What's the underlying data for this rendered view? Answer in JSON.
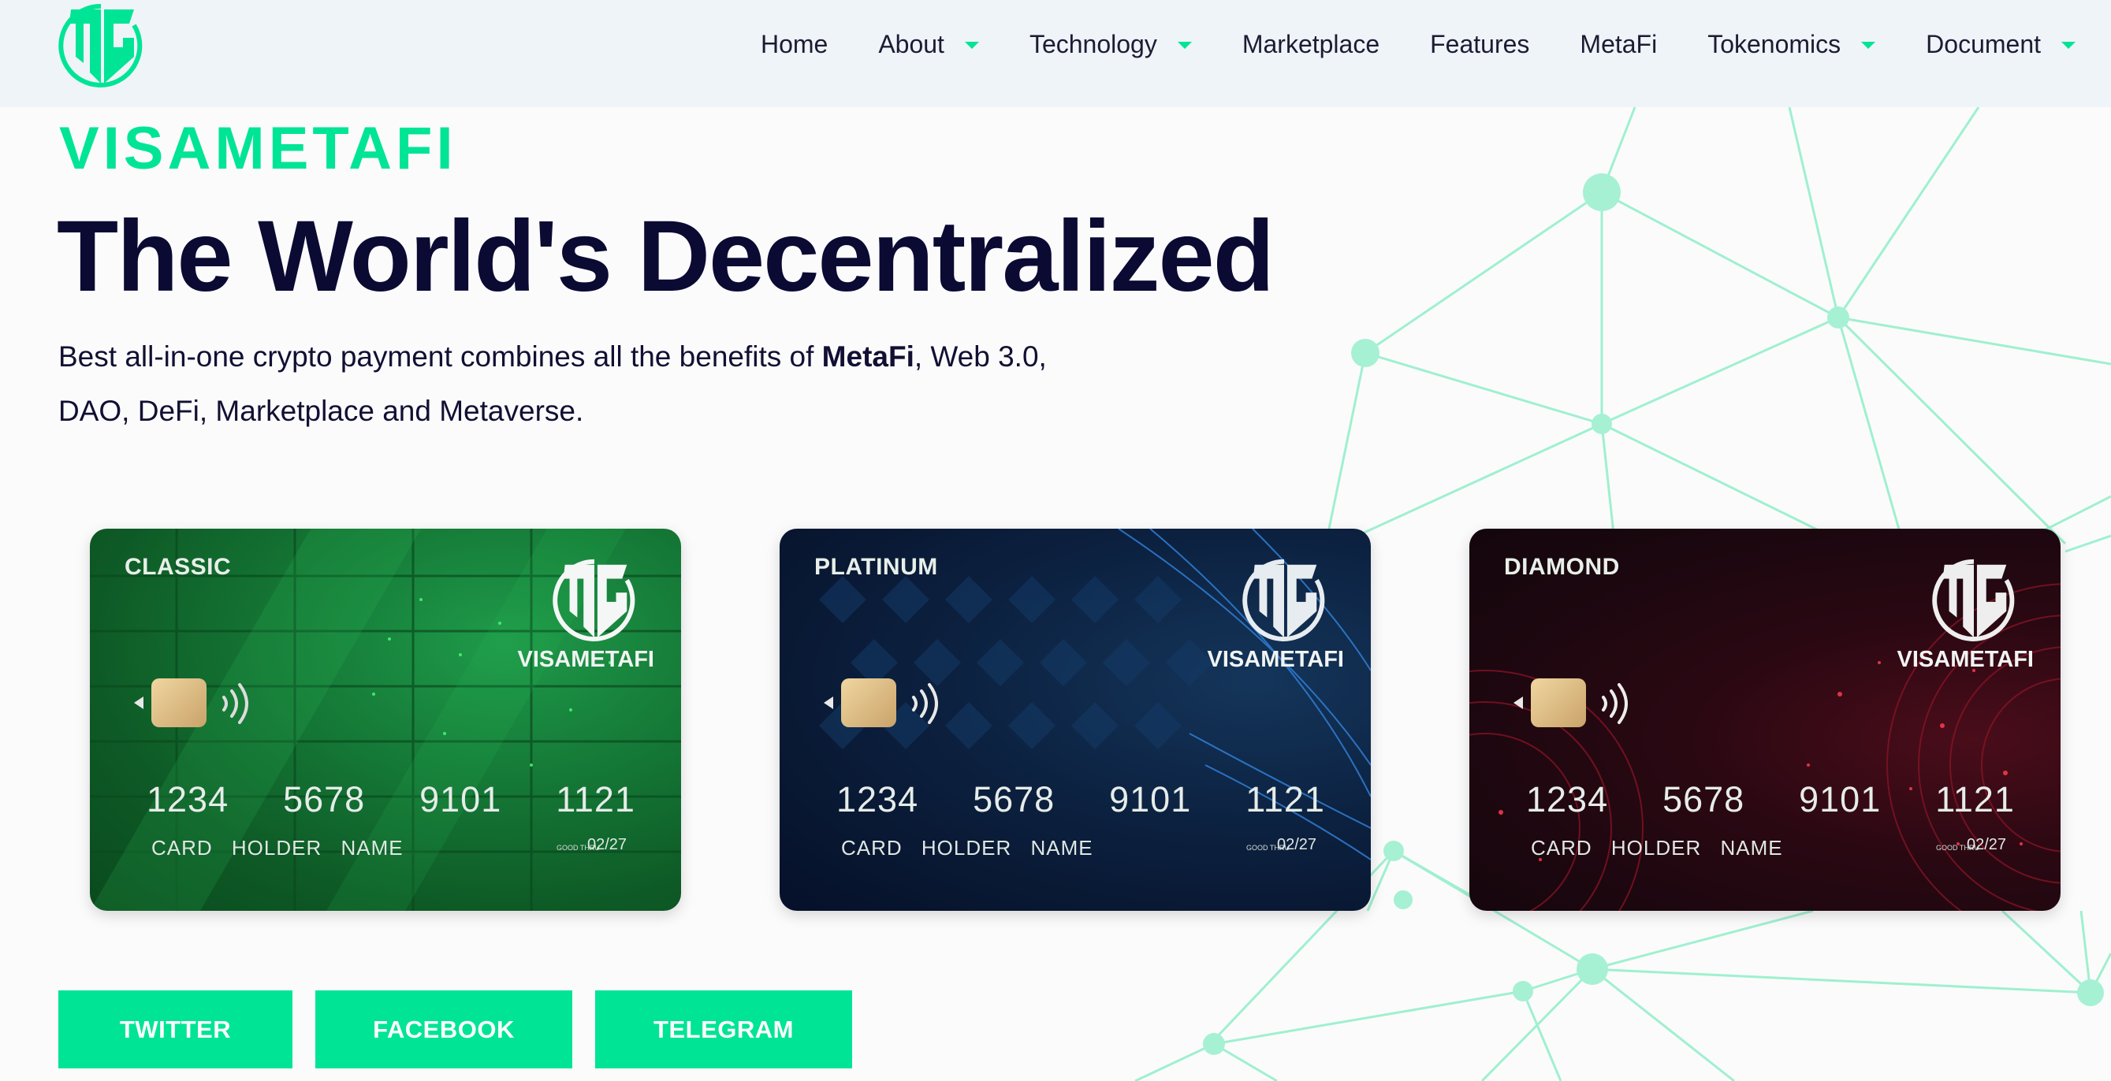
{
  "nav": {
    "logo_icon": "visametafi-monogram-logo",
    "items": [
      {
        "label": "Home",
        "has_dropdown": false
      },
      {
        "label": "About",
        "has_dropdown": true
      },
      {
        "label": "Technology",
        "has_dropdown": true
      },
      {
        "label": "Marketplace",
        "has_dropdown": false
      },
      {
        "label": "Features",
        "has_dropdown": false
      },
      {
        "label": "MetaFi",
        "has_dropdown": false
      },
      {
        "label": "Tokenomics",
        "has_dropdown": true
      },
      {
        "label": "Document",
        "has_dropdown": true
      }
    ]
  },
  "hero": {
    "brand": "VISAMETAFI",
    "headline": "The World's Decentralized",
    "description_before": "Best all-in-one crypto payment combines all the benefits of ",
    "description_bold": "MetaFi",
    "description_after": ", Web 3.0, DAO, DeFi, Marketplace and Metaverse."
  },
  "cards": [
    {
      "tier": "CLASSIC",
      "brand": "VISAMETAFI",
      "number": [
        "1234",
        "5678",
        "9101",
        "1121"
      ],
      "holder": "CARD HOLDER NAME",
      "good_thru": "GOOD THRU",
      "expiry": "02/27",
      "color": "#117a3a"
    },
    {
      "tier": "PLATINUM",
      "brand": "VISAMETAFI",
      "number": [
        "1234",
        "5678",
        "9101",
        "1121"
      ],
      "holder": "CARD HOLDER NAME",
      "good_thru": "GOOD THRU",
      "expiry": "02/27",
      "color": "#0a1c38"
    },
    {
      "tier": "DIAMOND",
      "brand": "VISAMETAFI",
      "number": [
        "1234",
        "5678",
        "9101",
        "1121"
      ],
      "holder": "CARD HOLDER NAME",
      "good_thru": "GOOD THRU",
      "expiry": "02/27",
      "color": "#1d0710"
    }
  ],
  "social": {
    "twitter": "TWITTER",
    "facebook": "FACEBOOK",
    "telegram": "TELEGRAM"
  },
  "colors": {
    "accent": "#00e496",
    "headline": "#0b0a33",
    "nav_background": "#eef4f7",
    "network_lines": "#9ff0cf"
  }
}
